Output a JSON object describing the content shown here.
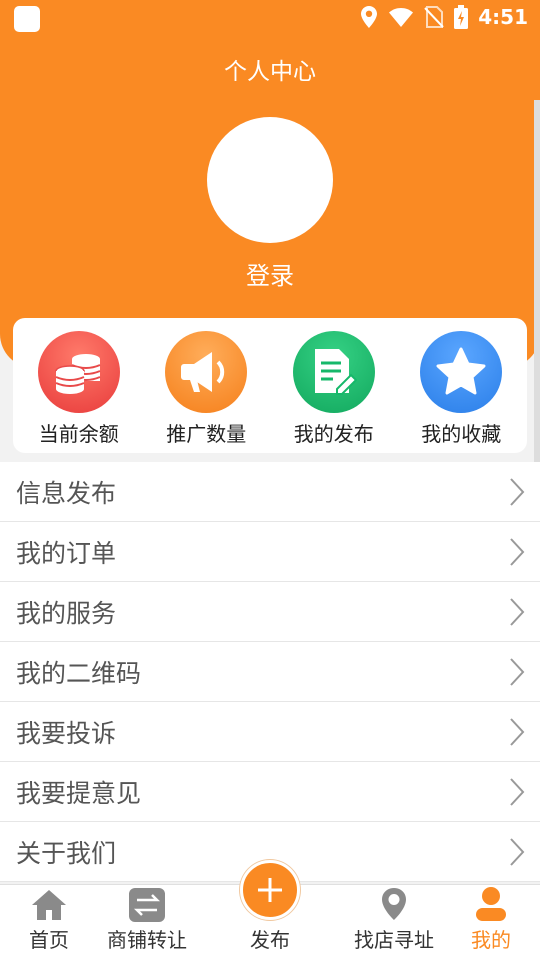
{
  "status_bar": {
    "time": "4:51"
  },
  "header": {
    "title": "个人中心",
    "login_label": "登录"
  },
  "quick_actions": [
    {
      "label": "当前余额",
      "icon": "coins-icon",
      "color": "#f04747"
    },
    {
      "label": "推广数量",
      "icon": "megaphone-icon",
      "color": "#fa8a23"
    },
    {
      "label": "我的发布",
      "icon": "document-edit-icon",
      "color": "#16b86a"
    },
    {
      "label": "我的收藏",
      "icon": "star-icon",
      "color": "#2e86f0"
    }
  ],
  "menu": [
    {
      "label": "信息发布"
    },
    {
      "label": "我的订单"
    },
    {
      "label": "我的服务"
    },
    {
      "label": "我的二维码"
    },
    {
      "label": "我要投诉"
    },
    {
      "label": "我要提意见"
    },
    {
      "label": "关于我们"
    }
  ],
  "tabbar": {
    "home": "首页",
    "transfer": "商铺转让",
    "publish": "发布",
    "find": "找店寻址",
    "mine": "我的",
    "active": "mine"
  },
  "colors": {
    "accent": "#fa8a23"
  }
}
